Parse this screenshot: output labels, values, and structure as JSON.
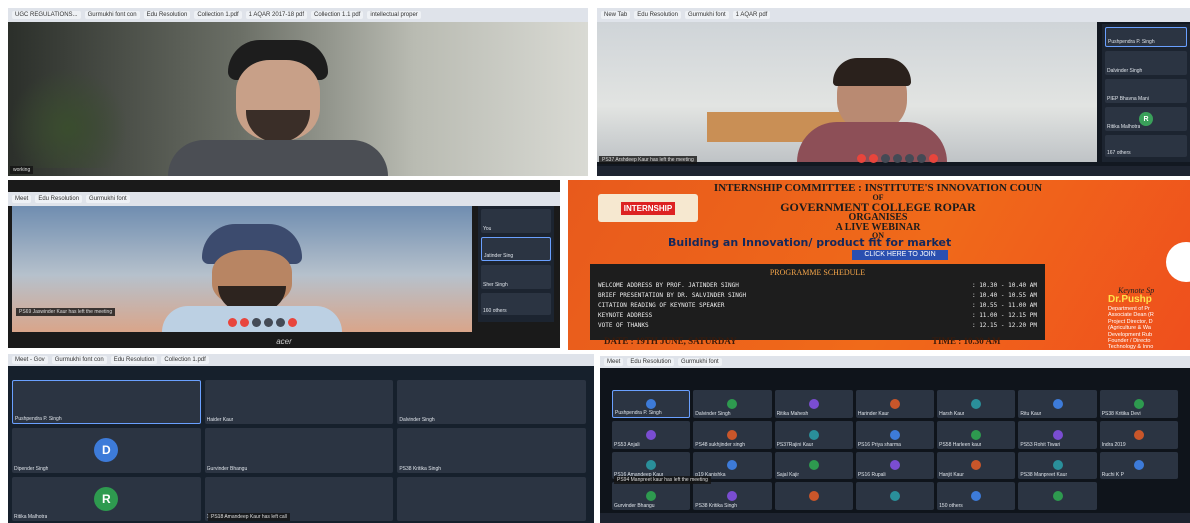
{
  "panel1": {
    "tabs": [
      "UGC REGULATIONS...",
      "Gurmukhi font con",
      "Edu Resolution",
      "Collection 1.pdf",
      "1 AQAR 2017-18 pdf",
      "Collection 1.1 pdf",
      "intellectual proper"
    ],
    "name_label": "working"
  },
  "panel2": {
    "participants": [
      "Pushpendra P. Singh",
      "Dalvinder Singh",
      "PIEP Bhavna Mani",
      "Ritika Malhotra",
      "167 others"
    ],
    "tile_letter": "R",
    "notice": "PS37 Arshdeep Kaur has left the meeting"
  },
  "panel3": {
    "participants": [
      "You",
      "Jatinder Sing",
      "Sher Singh",
      "160 others"
    ],
    "notice": "PS69 Jaswinder Kaur has left the meeting",
    "brand": "acer"
  },
  "poster": {
    "header": "INTERNSHIP COMMITTEE : INSTITUTE'S INNOVATION COUN",
    "of": "OF",
    "college": "GOVERNMENT COLLEGE ROPAR",
    "organises": "ORGANISES",
    "webinar": "A LIVE WEBINAR",
    "on": "ON",
    "topic": "Building an Innovation/ product fit for market",
    "join": "CLICK HERE TO JOIN",
    "logo_word": "INTERNSHIP",
    "schedule_title": "PROGRAMME SCHEDULE",
    "schedule": [
      {
        "item": "WELCOME ADDRESS BY PROF. JATINDER SINGH",
        "time": ": 10.30 - 10.40 AM"
      },
      {
        "item": "BRIEF PRESENTATION BY DR. SALVINDER SINGH",
        "time": ": 10.40 - 10.55 AM"
      },
      {
        "item": "CITATION READING OF KEYNOTE SPEAKER",
        "time": ": 10.55 - 11.00 AM"
      },
      {
        "item": "KEYNOTE ADDRESS",
        "time": ": 11.00 - 12.15 PM"
      },
      {
        "item": "VOTE OF THANKS",
        "time": ": 12.15 - 12.20 PM"
      }
    ],
    "date": "DATE : 19TH JUNE, SATURDAY",
    "time": "TIME : 10.30 AM",
    "speaker_caption": "Keynote Sp",
    "speaker_name": "Dr.Pushp",
    "speaker_lines": [
      "Department of Pr",
      "Associate Dean (R",
      "Project Director, D",
      "(Agriculture & Wa",
      "Development Rub",
      "Founder / Directo",
      "Technology & Inno"
    ]
  },
  "panel5": {
    "tiles": [
      {
        "name": "Pushpendra P. Singh",
        "letter": ""
      },
      {
        "name": "Haider Kaur",
        "letter": ""
      },
      {
        "name": "Dalvinder Singh",
        "letter": ""
      },
      {
        "name": "Dipender Singh",
        "letter": "D"
      },
      {
        "name": "Gurvinder Bhangu",
        "letter": ""
      },
      {
        "name": "PS38 Kritika Singh",
        "letter": ""
      },
      {
        "name": "Ritika Malhotra",
        "letter": "R"
      },
      {
        "name": "163 others",
        "letter": ""
      },
      {
        "name": "",
        "letter": ""
      }
    ],
    "notice": "PS18 Amandeep Kaur has left call"
  },
  "panel6": {
    "tiles": [
      "Pushpendra P. Singh",
      "Dalvinder Singh",
      "Ritika Mahesh",
      "Harinder Kaur",
      "Harsh Kaur",
      "Ritu Kaur",
      "PS38 Kritika Devi",
      "PS53 Anjali",
      "PS48 sukhjinder singh",
      "PS37Rajini Kaur",
      "PS16 Priya sharma",
      "PS58 Harleen kaur",
      "PS53 Rohit Tiwari",
      "Indra 2019",
      "PS16 Amandeep Kaur",
      "p19 Kanishka",
      "Sajal Kajir",
      "PS16 Rupali",
      "Hanjit Kaur",
      "PS38 Manpreet Kaur",
      "Ruchi K P",
      "Gurvinder Bhangu",
      "PS38 Kritika Singh",
      "",
      "",
      "150 others",
      ""
    ],
    "notice": "PS94 Manpreet kaur has left the meeting"
  }
}
